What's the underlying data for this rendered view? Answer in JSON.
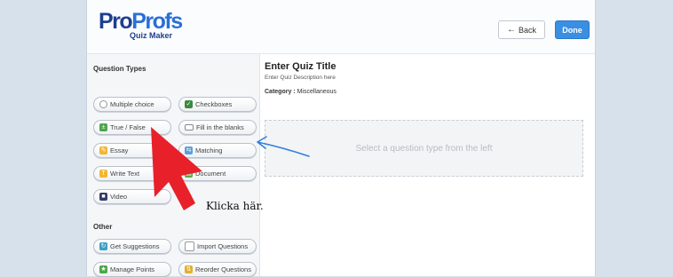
{
  "header": {
    "logo": {
      "part1": "Pro",
      "part2": "Profs",
      "subtitle": "Quiz Maker"
    },
    "back_label": "Back",
    "done_label": "Done"
  },
  "sidebar": {
    "question_types_title": "Question Types",
    "types": [
      {
        "label": "Multiple choice",
        "icon": "radio-icon"
      },
      {
        "label": "Checkboxes",
        "icon": "checkbox-icon"
      },
      {
        "label": "True / False",
        "icon": "true-false-icon"
      },
      {
        "label": "Fill in the blanks",
        "icon": "blank-field-icon"
      },
      {
        "label": "Essay",
        "icon": "pencil-icon"
      },
      {
        "label": "Matching",
        "icon": "matching-icon"
      },
      {
        "label": "Write Text",
        "icon": "text-icon"
      },
      {
        "label": "Document",
        "icon": "document-icon"
      },
      {
        "label": "Video",
        "icon": "film-icon"
      }
    ],
    "other_title": "Other",
    "other": [
      {
        "label": "Get Suggestions",
        "icon": "suggestions-icon"
      },
      {
        "label": "Import Questions",
        "icon": "import-icon"
      },
      {
        "label": "Manage Points",
        "icon": "points-icon"
      },
      {
        "label": "Reorder Questions",
        "icon": "reorder-icon"
      }
    ]
  },
  "main": {
    "title": "Enter Quiz Title",
    "description": "Enter Quiz Description here",
    "category_label": "Category :",
    "category_value": "Miscellaneous",
    "dropzone_text": "Select a question type from the left"
  },
  "annotation": {
    "text": "Klicka här.",
    "arrow_color": "#e8202a",
    "pointer_color": "#2f7fe0"
  },
  "colors": {
    "brand_dark": "#1d3f8f",
    "brand_light": "#2a6fd6",
    "done_button": "#3a8fe3",
    "background": "#d7e1ec"
  }
}
